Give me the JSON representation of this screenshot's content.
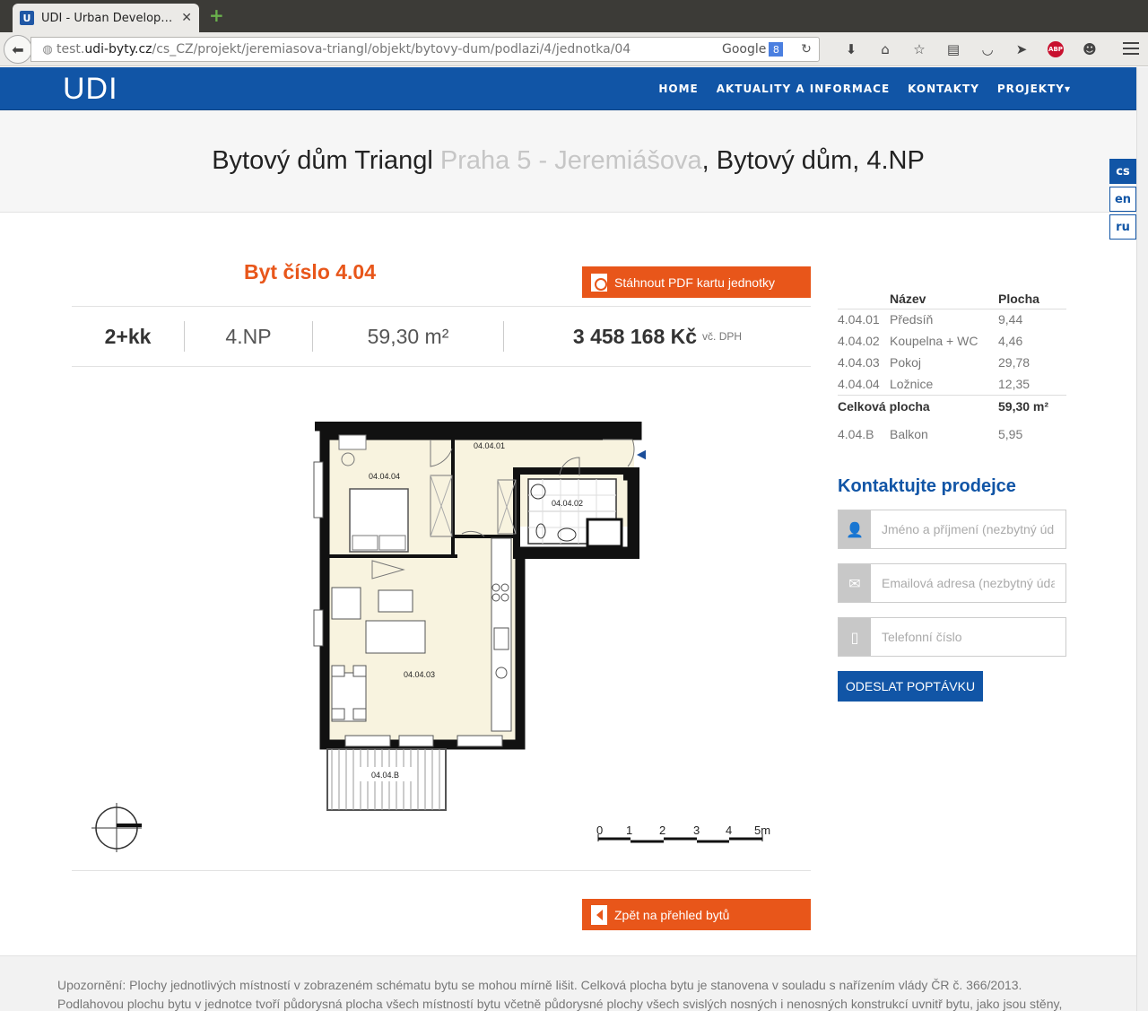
{
  "browser": {
    "tab_title": "UDI - Urban Develop…",
    "tab_favicon": "U",
    "url_prefix": "test.",
    "url_domain": "udi-byty.cz",
    "url_path": "/cs_CZ/projekt/jeremiasova-triangl/objekt/bytovy-dum/podlazi/4/jednotka/04",
    "search_engine": "Google"
  },
  "site": {
    "logo": "UDI",
    "nav": [
      "HOME",
      "AKTUALITY A INFORMACE",
      "KONTAKTY",
      "PROJEKTY▾"
    ],
    "accent_color": "#1155a6",
    "orange_color": "#e8561a"
  },
  "hero": {
    "title_a": "Bytový dům Triangl",
    "title_muted": "Praha 5 - Jeremiášova",
    "title_b": ", Bytový dům, 4.NP"
  },
  "languages": [
    "cs",
    "en",
    "ru"
  ],
  "unit": {
    "title": "Byt číslo 4.04",
    "pdf_button": "Stáhnout PDF kartu jednotky",
    "layout": "2+kk",
    "floor": "4.NP",
    "area": "59,30 m²",
    "price": "3 458 168 Kč",
    "price_note": "vč. DPH",
    "back_button": "Zpět na přehled bytů"
  },
  "plan": {
    "rooms": [
      "04.04.01",
      "04.04.02",
      "04.04.03",
      "04.04.04",
      "04.04.B"
    ],
    "scale_labels": [
      "0",
      "1",
      "2",
      "3",
      "4",
      "5m"
    ]
  },
  "areas": {
    "header_name": "Název",
    "header_area": "Plocha",
    "rows": [
      {
        "code": "4.04.01",
        "name": "Předsíň",
        "area": "9,44"
      },
      {
        "code": "4.04.02",
        "name": "Koupelna + WC",
        "area": "4,46"
      },
      {
        "code": "4.04.03",
        "name": "Pokoj",
        "area": "29,78"
      },
      {
        "code": "4.04.04",
        "name": "Ložnice",
        "area": "12,35"
      }
    ],
    "total_label": "Celková plocha",
    "total_value": "59,30 m²",
    "extra": {
      "code": "4.04.B",
      "name": "Balkon",
      "area": "5,95"
    }
  },
  "contact": {
    "title": "Kontaktujte prodejce",
    "name_placeholder": "Jméno a příjmení (nezbytný úda",
    "email_placeholder": "Emailová adresa (nezbytný údaj",
    "phone_placeholder": "Telefonní číslo",
    "submit": "ODESLAT POPTÁVKU"
  },
  "footer": {
    "line1": "Upozornění: Plochy jednotlivých místností v zobrazeném schématu bytu se mohou mírně lišit. Celková plocha bytu je stanovena v souladu s nařízením vlády ČR č. 366/2013.",
    "line2": "Podlahovou plochu bytu v jednotce tvoří půdorysná plocha všech místností bytu včetně půdorysné plochy všech svislých nosných i nenosných konstrukcí uvnitř bytu, jako jsou stěny,"
  }
}
